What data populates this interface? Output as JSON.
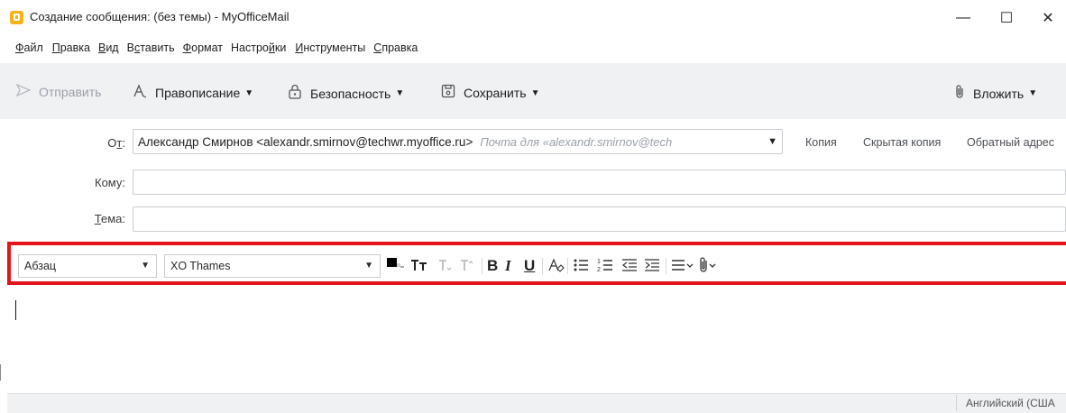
{
  "window": {
    "title": "Создание сообщения: (без темы) - MyOfficeMail",
    "minimize": "—",
    "maximize": "☐",
    "close": "✕"
  },
  "menu": {
    "items": [
      {
        "pre": "",
        "key": "Ф",
        "post": "айл"
      },
      {
        "pre": "",
        "key": "П",
        "post": "равка"
      },
      {
        "pre": "",
        "key": "В",
        "post": "ид"
      },
      {
        "pre": "В",
        "key": "с",
        "post": "тавить"
      },
      {
        "pre": "",
        "key": "Ф",
        "post": "ормат"
      },
      {
        "pre": "Настро",
        "key": "й",
        "post": "ки"
      },
      {
        "pre": "",
        "key": "И",
        "post": "нструменты"
      },
      {
        "pre": "",
        "key": "С",
        "post": "правка"
      }
    ]
  },
  "toolbar": {
    "send": "Отправить",
    "spelling": "Правописание",
    "security": "Безопасность",
    "save": "Сохранить",
    "attach": "Вложить",
    "send_icon": "send-icon",
    "spelling_icon": "spelling-icon",
    "security_icon": "lock-icon",
    "save_icon": "save-icon",
    "attach_icon": "paperclip-icon"
  },
  "header": {
    "from_label_main": "О",
    "from_label_key": "т",
    "from_label_colon": ":",
    "from_value": "Александр Смирнов <alexandr.smirnov@techwr.myoffice.ru>",
    "from_placeholder": "Почта для «alexandr.smirnov@tech",
    "to_label": "Кому:",
    "subject_key": "Т",
    "subject_rest": "ема:",
    "cc": "Копия",
    "bcc": "Скрытая копия",
    "reply_to": "Обратный адрес"
  },
  "format": {
    "paragraph_style": "Абзац",
    "font": "XO Thames",
    "bold": "B",
    "italic": "I",
    "underline": "U"
  },
  "status": {
    "language": "Английский (США"
  },
  "colors": {
    "highlight_border": "#e3141c",
    "toolbar_bg": "#f0f1f3",
    "logo": "#f5b21b"
  }
}
